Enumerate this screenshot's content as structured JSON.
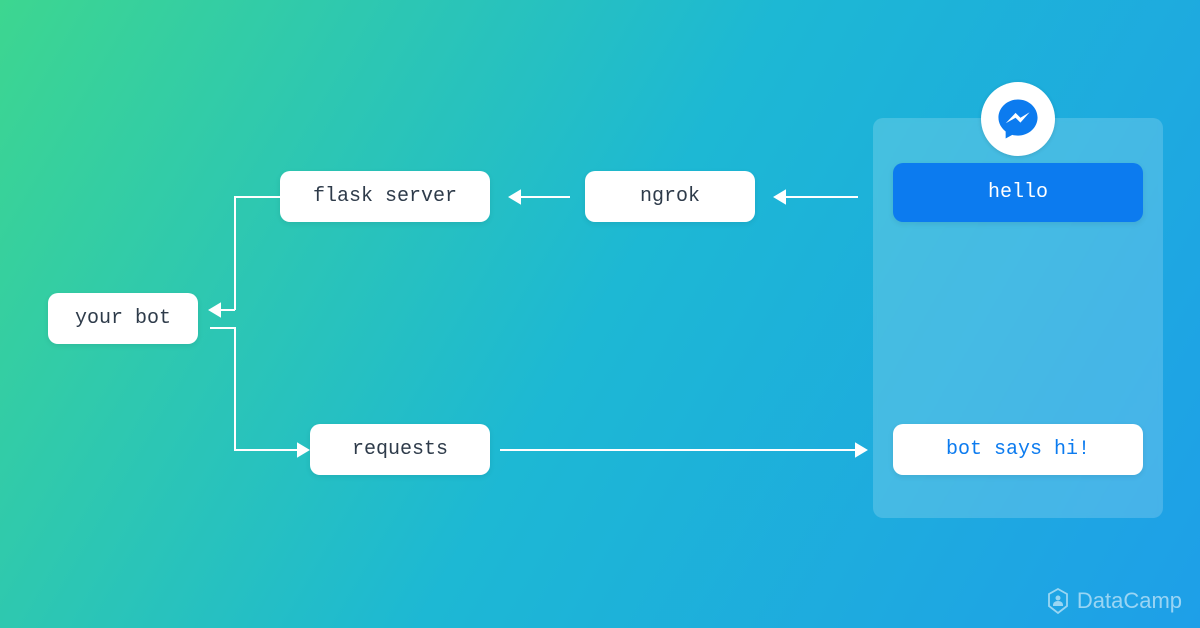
{
  "nodes": {
    "your_bot": "your bot",
    "flask_server": "flask server",
    "ngrok": "ngrok",
    "requests": "requests",
    "hello": "hello",
    "bot_reply": "bot says hi!"
  },
  "watermark": "DataCamp",
  "colors": {
    "messenger_blue": "#0C7BEF",
    "gradient_start": "#3DD690",
    "gradient_end": "#1E9FE8"
  }
}
